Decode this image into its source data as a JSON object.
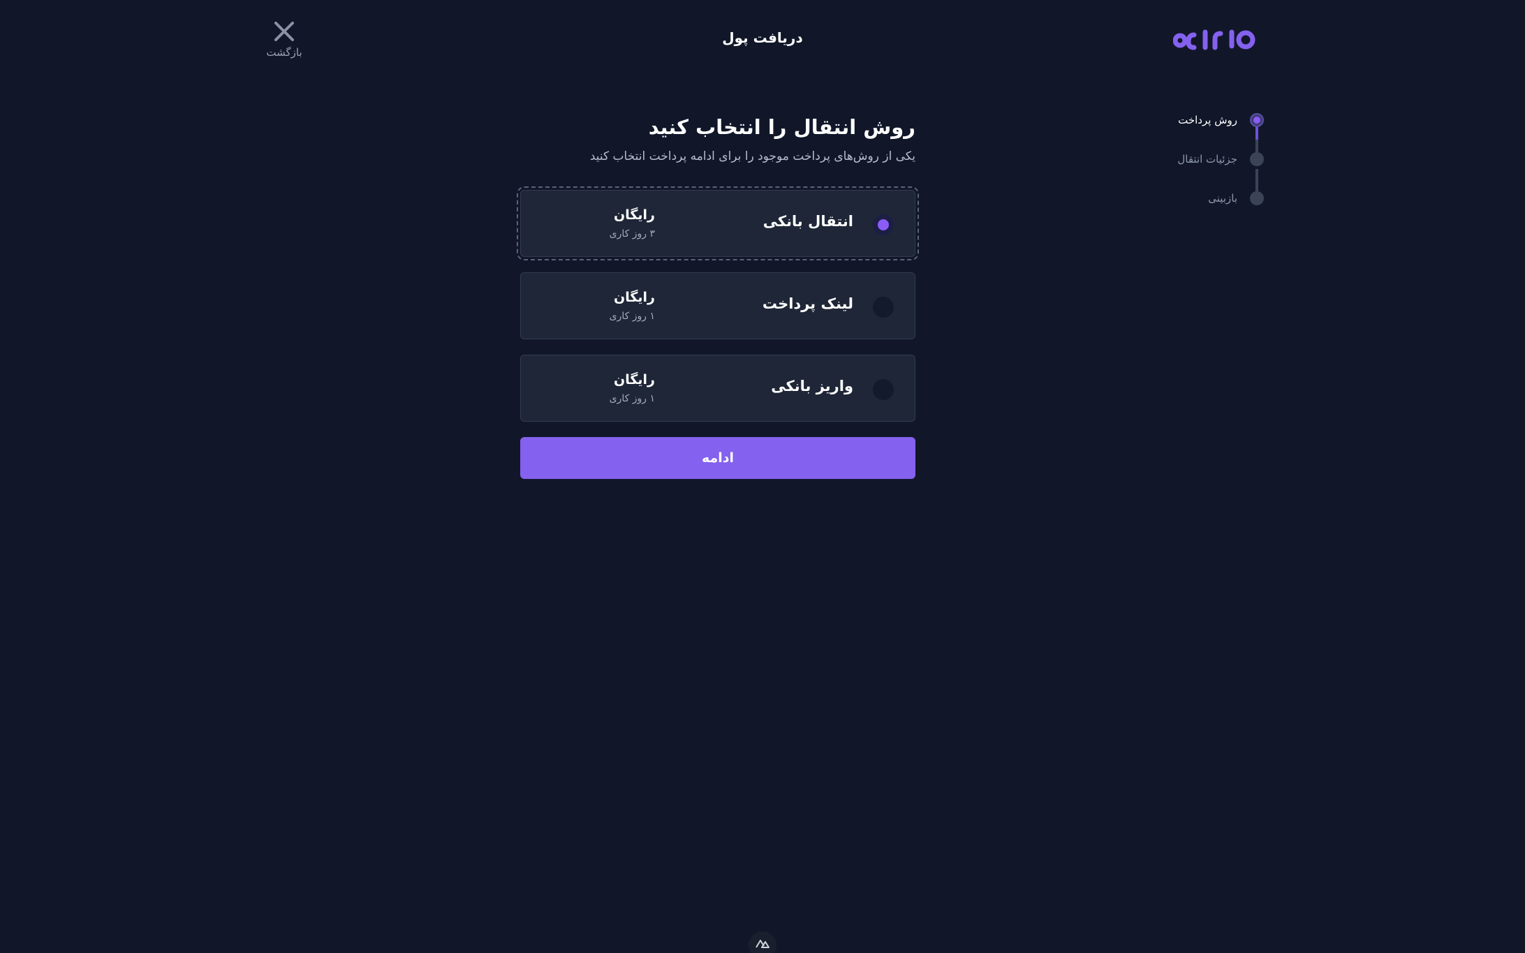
{
  "header": {
    "back_label": "بازگشت",
    "title": "دریافت پول",
    "logo_text": "ونتاپرو"
  },
  "stepper": {
    "steps": [
      {
        "label": "روش پرداخت",
        "state": "active"
      },
      {
        "label": "جزئیات انتقال",
        "state": "pending"
      },
      {
        "label": "بازبینی",
        "state": "pending"
      }
    ]
  },
  "main": {
    "heading": "روش انتقال را انتخاب کنید",
    "subheading": "یکی از روش‌های پرداخت موجود را برای ادامه پرداخت انتخاب کنید",
    "options": [
      {
        "name": "انتقال بانکی",
        "price": "رایگان",
        "time": "۳ روز کاری",
        "selected": true
      },
      {
        "name": "لینک پرداخت",
        "price": "رایگان",
        "time": "۱ روز کاری",
        "selected": false
      },
      {
        "name": "واریز بانکی",
        "price": "رایگان",
        "time": "۱ روز کاری",
        "selected": false
      }
    ],
    "continue_label": "ادامه"
  },
  "colors": {
    "background": "#111729",
    "card": "#1e2637",
    "accent": "#8461ee",
    "radio_selected": "#8b5cf6"
  },
  "icons": {
    "close": "close-icon",
    "logo": "brand-logo",
    "footer_badge": "nuxt-icon"
  }
}
